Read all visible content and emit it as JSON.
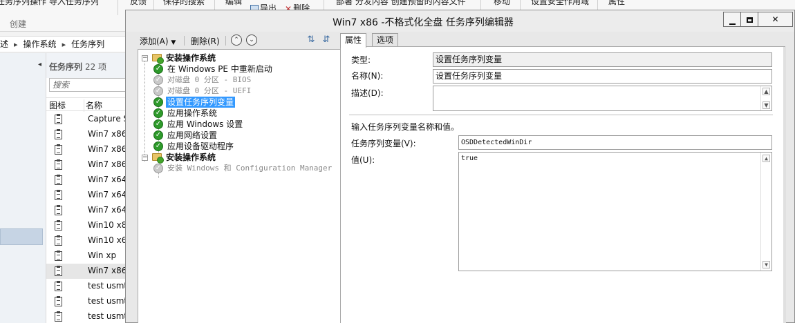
{
  "ribbon": {
    "items": [
      {
        "label": "任务序列操作  导入任务序列",
        "x": -5
      },
      {
        "label": "反馈"
      },
      {
        "label": "保存的搜索"
      },
      {
        "label": "编辑"
      },
      {
        "label": "导出"
      },
      {
        "label": "删除"
      },
      {
        "label": "部署  分发内容  创建预留的内容文件"
      },
      {
        "label": "移动"
      },
      {
        "label": "设置安全作用域"
      },
      {
        "label": "属性"
      }
    ],
    "group_label": "创建"
  },
  "breadcrumb": [
    "述",
    "操作系统",
    "任务序列"
  ],
  "list": {
    "title": "任务序列",
    "count": "22 项",
    "search_placeholder": "搜索",
    "col_icon": "图标",
    "col_name": "名称",
    "rows": [
      "Capture S",
      "Win7 x86",
      "Win7 x86",
      "Win7 x86",
      "Win7 x64",
      "Win7 x64",
      "Win7 x64",
      "Win10 x8",
      "Win10 x6",
      "Win xp",
      "Win7 x86",
      "test usmt",
      "test usmt",
      "test usmt"
    ],
    "selected_index": 10
  },
  "window": {
    "title": "Win7 x86 -不格式化全盘 任务序列编辑器",
    "close_glyph": "✕"
  },
  "toolbar": {
    "add_label": "添加(A)",
    "remove_label": "删除(R)"
  },
  "tree": {
    "group1": "安装操作系统",
    "step_restart": "在 Windows PE 中重新启动",
    "step_bios": "对磁盘 0 分区 - BIOS",
    "step_uefi": "对磁盘 0 分区 - UEFI",
    "step_setvar": "设置任务序列变量",
    "step_apply_os": "应用操作系统",
    "step_apply_win": "应用 Windows 设置",
    "step_apply_net": "应用网络设置",
    "step_apply_drv": "应用设备驱动程序",
    "group2": "安装操作系统",
    "step_install": "安装 Windows 和 Configuration Manager"
  },
  "tabs": {
    "properties": "属性",
    "options": "选项"
  },
  "props": {
    "type_label": "类型:",
    "type_value": "设置任务序列变量",
    "name_label": "名称(N):",
    "name_value": "设置任务序列变量",
    "desc_label": "描述(D):",
    "desc_value": "",
    "section_label": "输入任务序列变量名称和值。",
    "var_label": "任务序列变量(V):",
    "var_value": "OSDDetectedWinDir",
    "value_label": "值(U):",
    "value_value": "true"
  }
}
